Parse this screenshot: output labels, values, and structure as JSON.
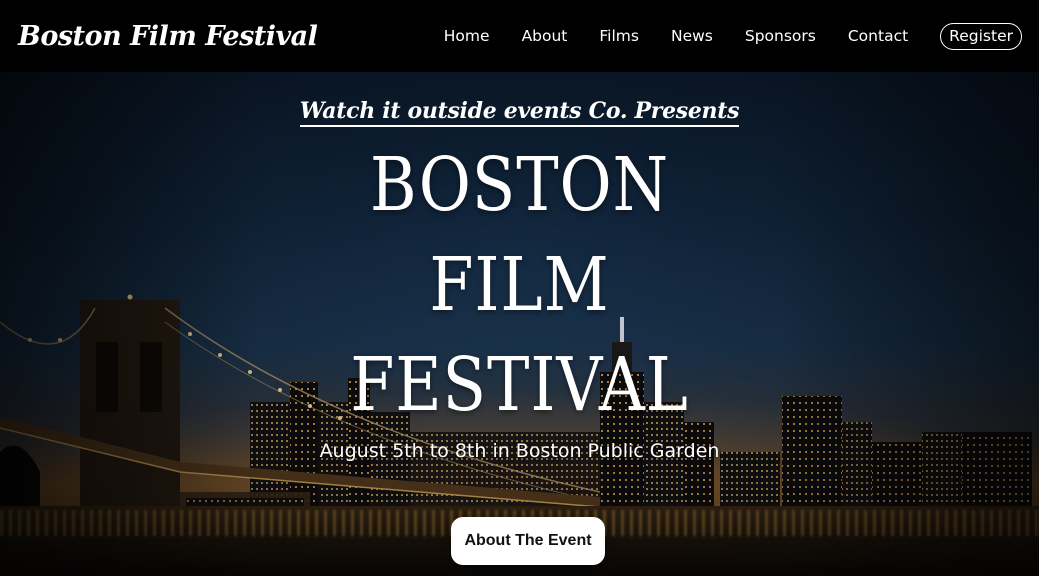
{
  "header": {
    "brand": "Boston Film Festival",
    "nav": [
      "Home",
      "About",
      "Films",
      "News",
      "Sponsors",
      "Contact"
    ],
    "register_label": "Register"
  },
  "hero": {
    "presents": "Watch it outside events Co. Presents",
    "title_lines": [
      "BOSTON",
      "FILM",
      "FESTIVAL"
    ],
    "dates": "August 5th to 8th in Boston Public Garden",
    "cta_label": "About The Event"
  },
  "colors": {
    "header_bg": "#000000",
    "text": "#ffffff",
    "cta_bg": "#ffffff",
    "cta_text": "#111111"
  }
}
